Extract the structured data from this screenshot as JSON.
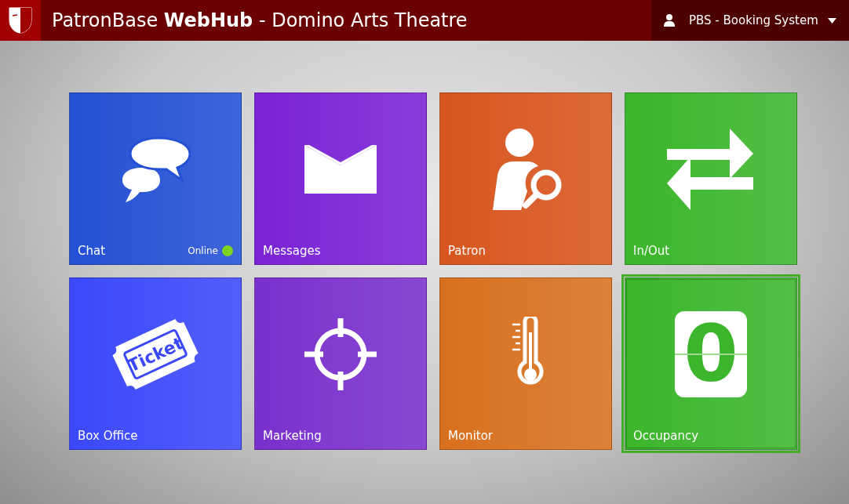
{
  "header": {
    "title_prefix": "PatronBase",
    "title_bold": "WebHub",
    "title_suffix": "- Domino Arts Theatre",
    "user": "PBS - Booking System"
  },
  "tiles": [
    {
      "label": "Chat",
      "kind": "chat",
      "color": "#2350d4",
      "selected": false,
      "status": {
        "text": "Online",
        "color": "#7ed321"
      }
    },
    {
      "label": "Messages",
      "kind": "messages",
      "color": "#7a22d6",
      "selected": false
    },
    {
      "label": "Patron",
      "kind": "patron",
      "color": "#d8561f",
      "selected": false
    },
    {
      "label": "In/Out",
      "kind": "inout",
      "color": "#3cb52c",
      "selected": false
    },
    {
      "label": "Box Office",
      "kind": "ticket",
      "color": "#3b48fa",
      "selected": false,
      "icon_text": "Ticket"
    },
    {
      "label": "Marketing",
      "kind": "target",
      "color": "#7a30cc",
      "selected": false
    },
    {
      "label": "Monitor",
      "kind": "thermometer",
      "color": "#d8701e",
      "selected": false
    },
    {
      "label": "Occupancy",
      "kind": "counter",
      "color": "#3cb52c",
      "selected": true,
      "icon_text": "0"
    }
  ]
}
